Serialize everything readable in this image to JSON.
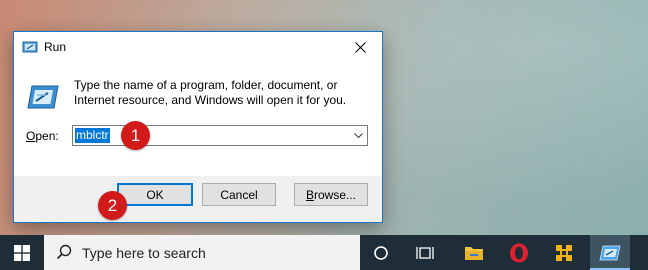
{
  "dialog": {
    "title": "Run",
    "message": "Type the name of a program, folder, document, or Internet resource, and Windows will open it for you.",
    "open_label_accel": "O",
    "open_label_rest": "pen:",
    "input_value": "mblctr",
    "ok_label": "OK",
    "cancel_label": "Cancel",
    "browse_label_accel": "B",
    "browse_label_rest": "rowse..."
  },
  "callouts": [
    "1",
    "2"
  ],
  "taskbar": {
    "search_placeholder": "Type here to search",
    "icons": [
      "windows-start-icon",
      "search-icon",
      "cortana-icon",
      "task-view-icon",
      "file-explorer-icon",
      "opera-icon",
      "app-icon",
      "run-icon"
    ]
  },
  "colors": {
    "accent": "#0078d7",
    "callout": "#d11a1a",
    "taskbar": "#1f2d38"
  }
}
